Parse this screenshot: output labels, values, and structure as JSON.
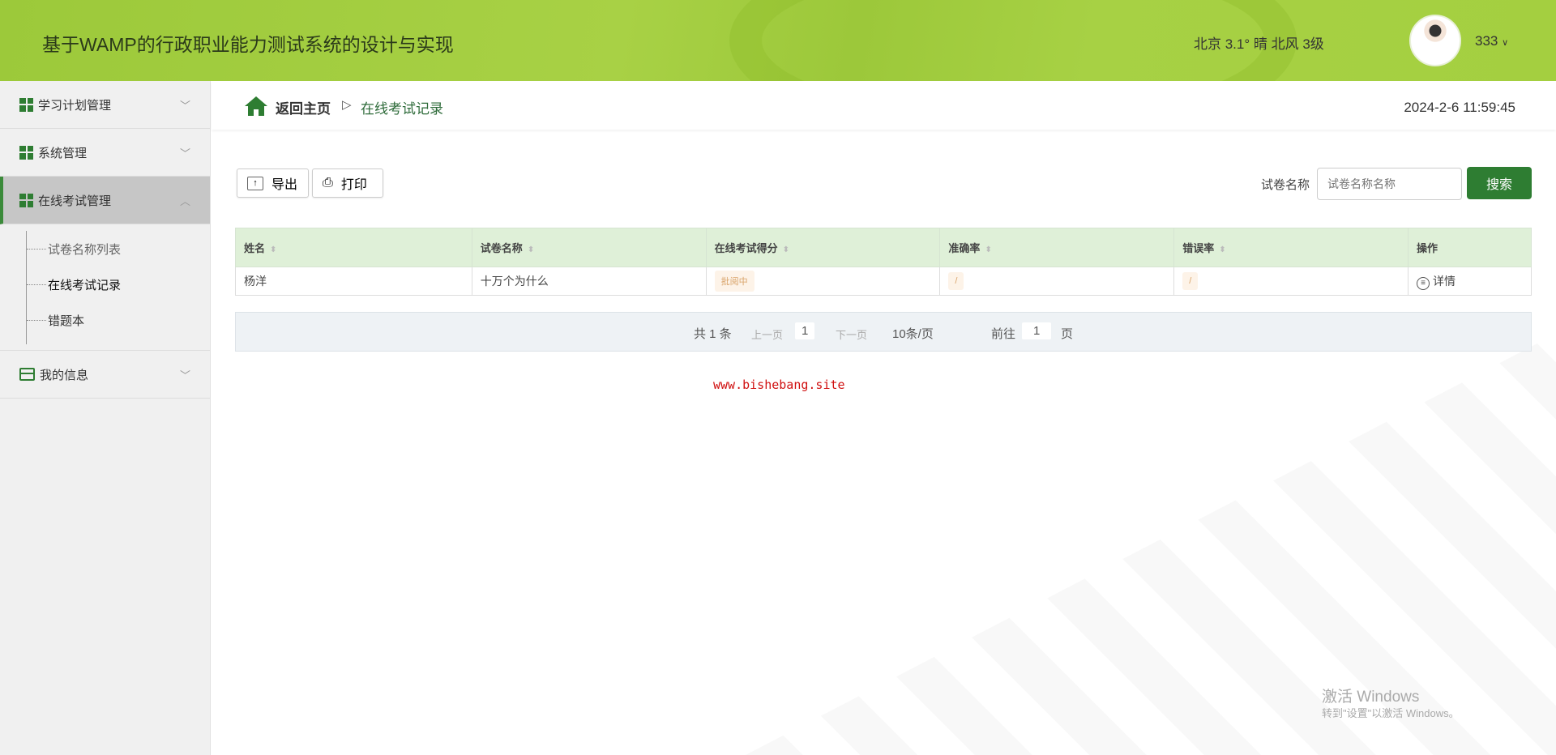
{
  "header": {
    "title": "基于WAMP的行政职业能力测试系统的设计与实现",
    "weather": "北京  3.1°  晴  北风  3级",
    "username": "333"
  },
  "sidebar": {
    "items": [
      {
        "label": "学习计划管理"
      },
      {
        "label": "系统管理"
      },
      {
        "label": "在线考试管理",
        "sub": [
          "试卷名称列表",
          "在线考试记录",
          "错题本"
        ]
      },
      {
        "label": "我的信息"
      }
    ]
  },
  "breadcrumb": {
    "home": "返回主页",
    "sep": "▷",
    "current": "在线考试记录",
    "datetime": "2024-2-6 11:59:45"
  },
  "toolbar": {
    "export": "导出",
    "print": "打印",
    "search_label": "试卷名称",
    "search_placeholder": "试卷名称名称",
    "search_button": "搜索"
  },
  "table": {
    "headers": [
      "姓名",
      "试卷名称",
      "在线考试得分",
      "准确率",
      "错误率",
      "操作"
    ],
    "rows": [
      {
        "name": "杨洋",
        "paper": "十万个为什么",
        "score": "批阅中",
        "accuracy": "/",
        "error": "/",
        "action": "详情"
      }
    ]
  },
  "pagination": {
    "total": "共 1 条",
    "prev": "上一页",
    "page": "1",
    "next": "下一页",
    "size": "10条/页",
    "goto": "前往",
    "goto_page": "1",
    "page_unit": "页"
  },
  "watermark": "www.bishebang.site",
  "windows": {
    "line1": "激活 Windows",
    "line2": "转到\"设置\"以激活 Windows。"
  }
}
